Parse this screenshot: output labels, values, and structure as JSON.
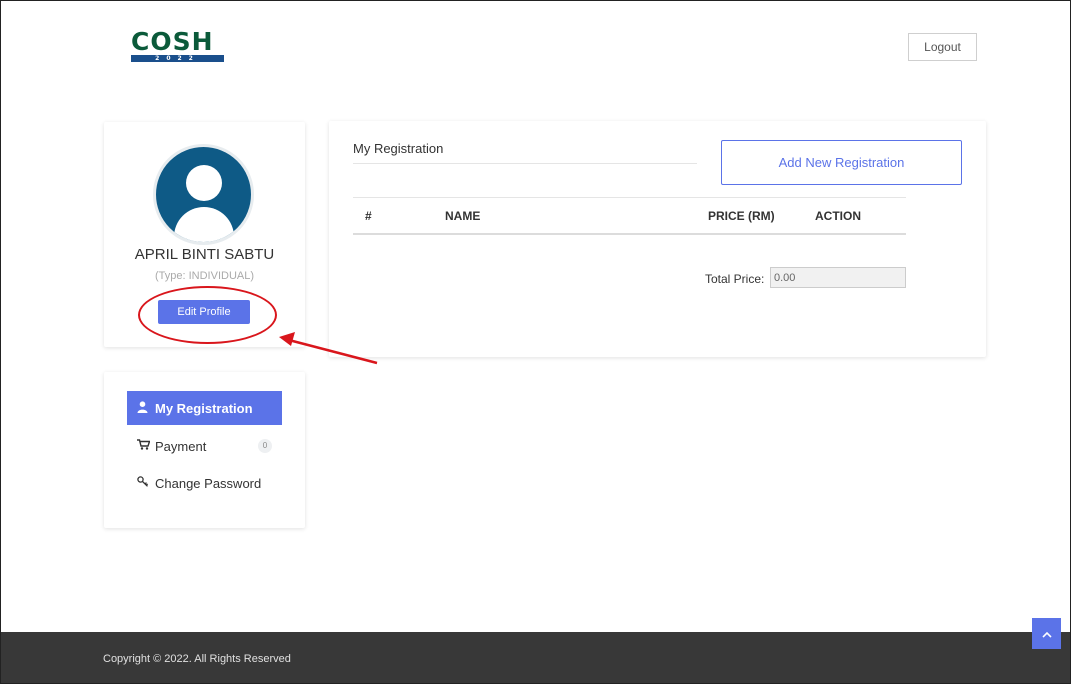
{
  "header": {
    "logo_text": "COSH",
    "logo_year": "2022",
    "logout_label": "Logout"
  },
  "profile": {
    "name": "APRIL BINTI SABTU",
    "type": "(Type: INDIVIDUAL)",
    "edit_label": "Edit Profile"
  },
  "menu": {
    "items": [
      {
        "label": "My Registration",
        "icon": "user-icon"
      },
      {
        "label": "Payment",
        "icon": "cart-icon",
        "badge": "0"
      },
      {
        "label": "Change Password",
        "icon": "key-icon"
      }
    ]
  },
  "registration": {
    "title": "My Registration",
    "add_label": "Add New Registration",
    "columns": [
      "#",
      "NAME",
      "PRICE (RM)",
      "ACTION"
    ],
    "total_label": "Total Price:",
    "total_value": "0.00"
  },
  "footer": {
    "copyright": "Copyright © 2022. All Rights Reserved"
  },
  "colors": {
    "accent": "#5b73e8",
    "annotation": "#d9161c",
    "footer_bg": "#383838",
    "avatar_bg": "#0e5a86"
  }
}
